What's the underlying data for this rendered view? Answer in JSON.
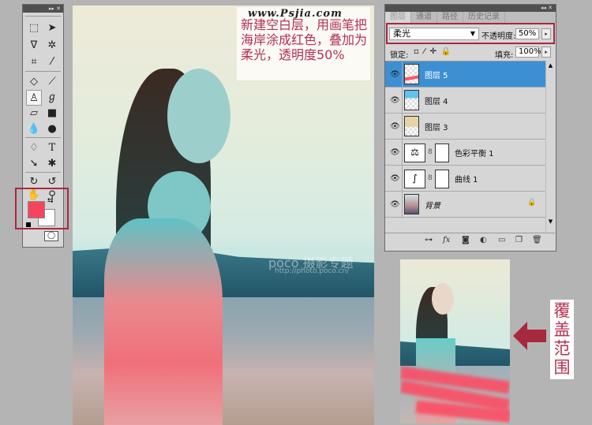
{
  "toolbar": {
    "tools": [
      "marquee",
      "move",
      "lasso",
      "magic-wand",
      "crop",
      "eyedropper",
      "healing",
      "brush",
      "clone-stamp",
      "history-brush",
      "eraser",
      "gradient",
      "blur",
      "dodge",
      "pen",
      "type",
      "path-select",
      "shape",
      "3d-rotate",
      "3d-orbit",
      "hand",
      "zoom"
    ],
    "foreground_color": "#f5455e",
    "background_color": "#ffffff"
  },
  "caption": {
    "url": "www.Psjia.com",
    "text": "新建空白层，用画笔把海岸涂成红色，叠加为柔光，透明度50%"
  },
  "watermark": {
    "brand": "poco 摄影专题",
    "url": "http://photo.poco.cn/"
  },
  "coverage_label": "覆盖范围",
  "layers_panel": {
    "tabs": [
      "图层",
      "通道",
      "路径",
      "历史记录"
    ],
    "blend_mode": "柔光",
    "opacity_label": "不透明度:",
    "opacity": "50%",
    "lock_label": "锁定:",
    "fill_label": "填充:",
    "fill": "100%",
    "layers": [
      {
        "name": "图层 5",
        "selected": true
      },
      {
        "name": "图层 4"
      },
      {
        "name": "图层 3"
      },
      {
        "name": "色彩平衡 1"
      },
      {
        "name": "曲线 1"
      },
      {
        "name": "背景",
        "locked": true
      }
    ]
  },
  "colors": {
    "accent_red": "#a8283e",
    "selection_blue": "#3c8fd2",
    "caption_text": "#b5304f"
  }
}
